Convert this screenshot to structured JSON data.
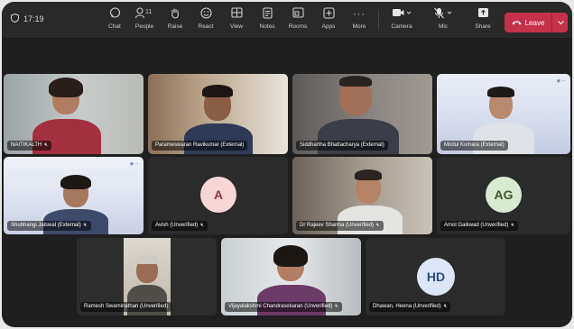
{
  "toolbar": {
    "timer": "17:19",
    "people_count": "11",
    "items": [
      {
        "label": "Chat",
        "icon": "chat-icon"
      },
      {
        "label": "People",
        "icon": "people-icon"
      },
      {
        "label": "Raise",
        "icon": "raise-hand-icon"
      },
      {
        "label": "React",
        "icon": "react-icon"
      },
      {
        "label": "View",
        "icon": "view-icon"
      },
      {
        "label": "Notes",
        "icon": "notes-icon"
      },
      {
        "label": "Rooms",
        "icon": "rooms-icon"
      },
      {
        "label": "Apps",
        "icon": "apps-icon"
      },
      {
        "label": "More",
        "icon": "more-icon"
      }
    ],
    "camera_label": "Camera",
    "mic_label": "Mic",
    "share_label": "Share",
    "leave_label": "Leave",
    "leave_color": "#c4314b"
  },
  "participants": [
    {
      "name": "NAITIKALTH",
      "avatar": ""
    },
    {
      "name": "Parameswaran Ravikumar (External)",
      "avatar": ""
    },
    {
      "name": "Siddhartha Bhattacharya (External)",
      "avatar": ""
    },
    {
      "name": "Mridul Kumara (External)",
      "avatar": ""
    },
    {
      "name": "Shubhangi Jaiswal (External)",
      "avatar": ""
    },
    {
      "name": "Avish (Unverified)",
      "avatar": "A"
    },
    {
      "name": "Dr Rajeev Sharma (Unverified)",
      "avatar": ""
    },
    {
      "name": "Amol Gaikwad (Unverified)",
      "avatar": "AG"
    },
    {
      "name": "Ramesh Swaminathan (Unverified)",
      "avatar": ""
    },
    {
      "name": "Vijayalakshmi Chandrasekaran (Unverified)",
      "avatar": ""
    },
    {
      "name": "Dhawan, Heena (Unverified)",
      "avatar": "HD"
    }
  ]
}
